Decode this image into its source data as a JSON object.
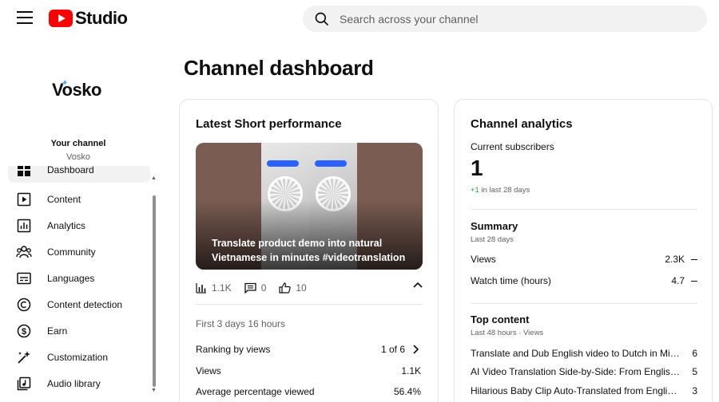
{
  "header": {
    "logo_text": "Studio",
    "search_placeholder": "Search across your channel"
  },
  "sidebar": {
    "brand_logo": "Vosko",
    "your_channel": "Your channel",
    "channel_name": "Vosko",
    "items": [
      {
        "label": "Dashboard",
        "icon": "dashboard-icon"
      },
      {
        "label": "Content",
        "icon": "content-icon"
      },
      {
        "label": "Analytics",
        "icon": "analytics-icon"
      },
      {
        "label": "Community",
        "icon": "community-icon"
      },
      {
        "label": "Languages",
        "icon": "subtitles-icon"
      },
      {
        "label": "Content detection",
        "icon": "copyright-icon"
      },
      {
        "label": "Earn",
        "icon": "dollar-icon"
      },
      {
        "label": "Customization",
        "icon": "magic-wand-icon"
      },
      {
        "label": "Audio library",
        "icon": "audio-library-icon"
      }
    ]
  },
  "main": {
    "page_title": "Channel dashboard",
    "latest_short": {
      "title": "Latest Short performance",
      "thumbnail_caption": "Translate product demo into natural Vietnamese in minutes #videotranslation",
      "views": "1.1K",
      "comments": "0",
      "likes": "10",
      "period": "First 3 days 16 hours",
      "ranking_label": "Ranking by views",
      "ranking_value": "1 of 6",
      "views_label": "Views",
      "views_value": "1.1K",
      "avg_pct_label": "Average percentage viewed",
      "avg_pct_value": "56.4%"
    },
    "channel_analytics": {
      "title": "Channel analytics",
      "subscribers_label": "Current subscribers",
      "subscribers_value": "1",
      "subscribers_delta": "+1",
      "subscribers_delta_suffix": "in last 28 days",
      "summary_title": "Summary",
      "summary_period": "Last 28 days",
      "summary_rows": [
        {
          "label": "Views",
          "value": "2.3K"
        },
        {
          "label": "Watch time (hours)",
          "value": "4.7"
        }
      ],
      "top_content_title": "Top content",
      "top_content_period": "Last 48 hours · Views",
      "top_content": [
        {
          "title": "Translate and Dub English video to Dutch in Minutes",
          "views": "6"
        },
        {
          "title": "AI Video Translation Side-by-Side: From English to Spanish",
          "views": "5"
        },
        {
          "title": "Hilarious Baby Clip Auto-Translated from English to Spanish",
          "views": "3"
        }
      ]
    }
  },
  "colors": {
    "brand_red": "#ff0000",
    "positive_green": "#2ba640",
    "muted_text": "#606060"
  }
}
